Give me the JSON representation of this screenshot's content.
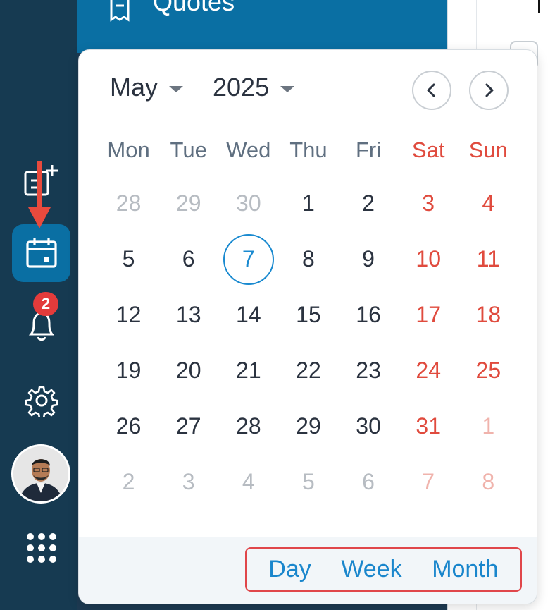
{
  "topbar": {
    "label": "Quotes",
    "icon": "receipt-icon"
  },
  "rail": {
    "items": [
      {
        "name": "new-calendar-icon"
      },
      {
        "name": "calendar-icon",
        "active": true
      },
      {
        "name": "bell-icon",
        "badge": "2"
      },
      {
        "name": "gear-icon"
      },
      {
        "name": "avatar"
      },
      {
        "name": "apps-grid-icon"
      }
    ]
  },
  "calendar": {
    "month": "May",
    "year": "2025",
    "weekdays": [
      "Mon",
      "Tue",
      "Wed",
      "Thu",
      "Fri",
      "Sat",
      "Sun"
    ],
    "weeks": [
      [
        "28",
        "29",
        "30",
        "1",
        "2",
        "3",
        "4"
      ],
      [
        "5",
        "6",
        "7",
        "8",
        "9",
        "10",
        "11"
      ],
      [
        "12",
        "13",
        "14",
        "15",
        "16",
        "17",
        "18"
      ],
      [
        "19",
        "20",
        "21",
        "22",
        "23",
        "24",
        "25"
      ],
      [
        "26",
        "27",
        "28",
        "29",
        "30",
        "31",
        "1"
      ],
      [
        "2",
        "3",
        "4",
        "5",
        "6",
        "7",
        "8"
      ]
    ],
    "today": "7",
    "views": {
      "day": "Day",
      "week": "Week",
      "month": "Month"
    }
  },
  "colors": {
    "rail": "#163a51",
    "accent": "#0a6fa3",
    "weekend": "#e04b3e",
    "highlight": "#e0464a"
  }
}
